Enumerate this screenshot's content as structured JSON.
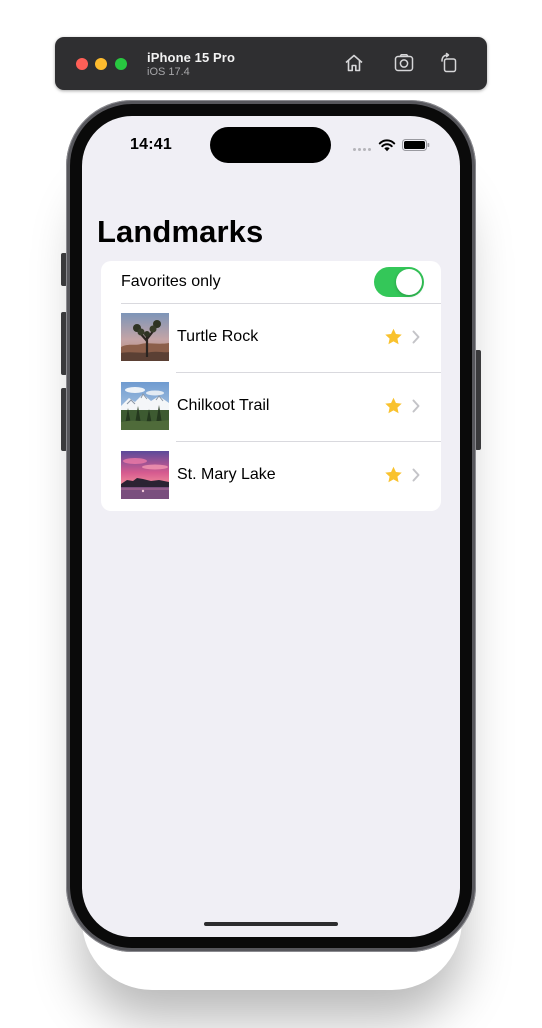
{
  "simulator": {
    "device_name": "iPhone 15 Pro",
    "os_version": "iOS 17.4",
    "icons": [
      "home-icon",
      "screenshot-icon",
      "rotate-icon"
    ]
  },
  "status_bar": {
    "time": "14:41",
    "icons": [
      "cellular-icon",
      "wifi-icon",
      "battery-icon"
    ]
  },
  "nav": {
    "title": "Landmarks"
  },
  "filter": {
    "label": "Favorites only",
    "is_on": true,
    "accent_color": "#34c759"
  },
  "landmarks": [
    {
      "name": "Turtle Rock",
      "is_favorite": true
    },
    {
      "name": "Chilkoot Trail",
      "is_favorite": true
    },
    {
      "name": "St. Mary Lake",
      "is_favorite": true
    }
  ],
  "colors": {
    "favorite_star": "#f9c22e",
    "screen_background": "#f0eff5"
  }
}
